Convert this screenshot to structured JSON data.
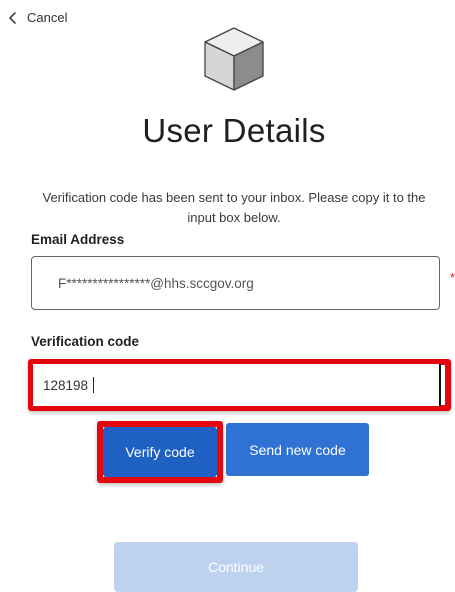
{
  "nav": {
    "cancel_label": "Cancel",
    "back_icon": "chevron-left-icon"
  },
  "header": {
    "logo_icon": "cube-icon",
    "title": "User Details"
  },
  "intro": {
    "text": "Verification code has been sent to your inbox. Please copy it to the input box below."
  },
  "email": {
    "label": "Email Address",
    "value": "F****************@hhs.sccgov.org",
    "required_marker": "*"
  },
  "verification": {
    "label": "Verification code",
    "value": "128198"
  },
  "buttons": {
    "verify_label": "Verify code",
    "send_new_label": "Send new code",
    "continue_label": "Continue"
  },
  "colors": {
    "primary": "#1f61c2",
    "secondary": "#2f72d4",
    "disabled": "#bcd2ef",
    "highlight": "#e2070e",
    "required": "#e02020"
  }
}
